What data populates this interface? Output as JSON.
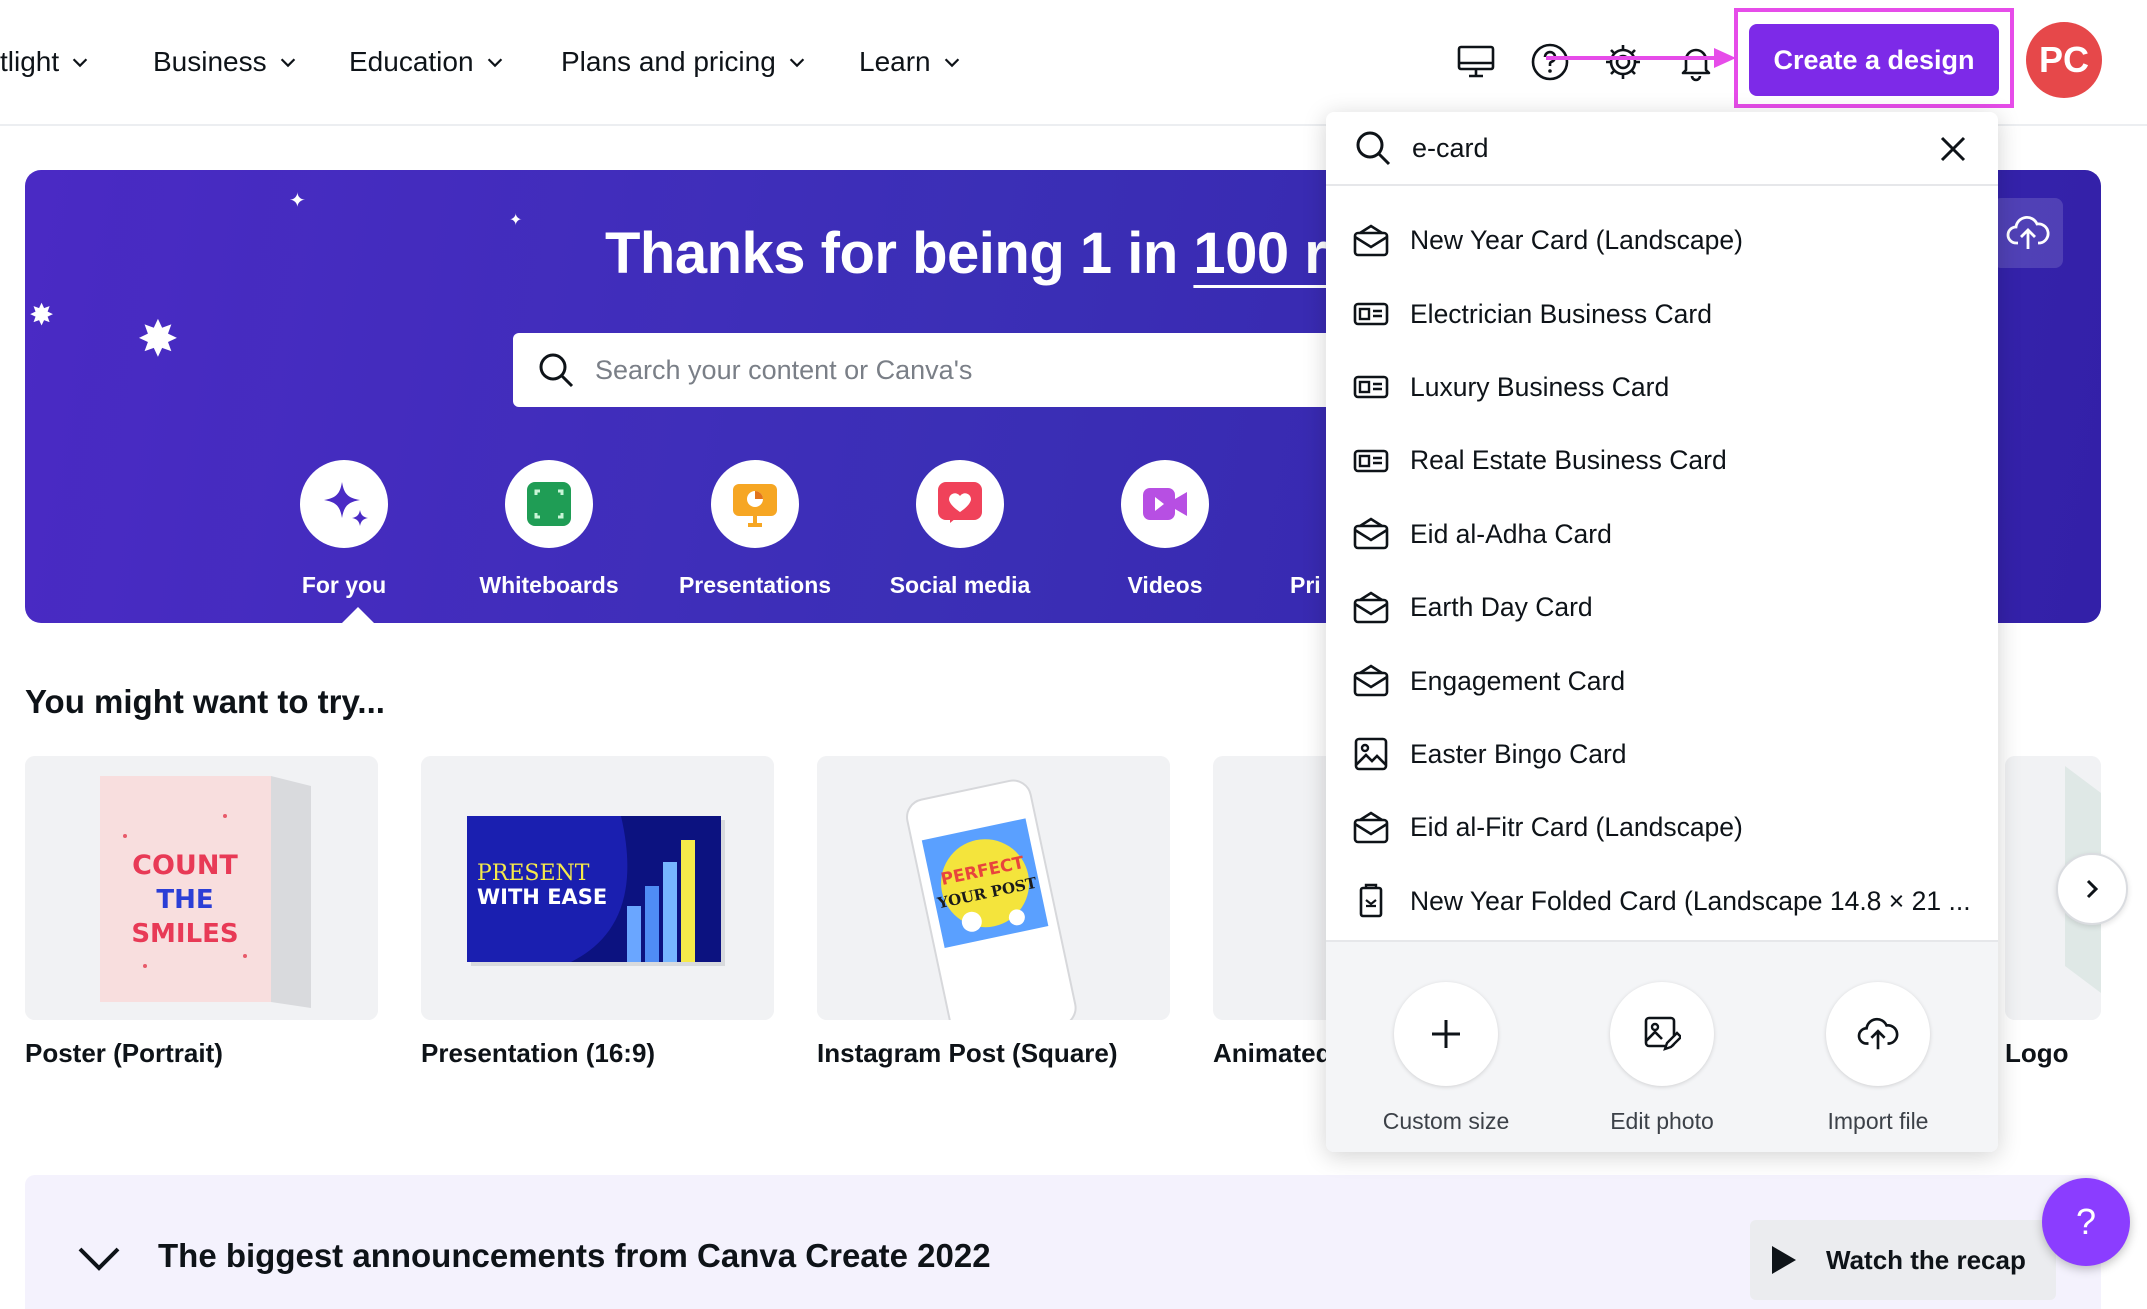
{
  "nav": {
    "items": [
      {
        "label": "tlight"
      },
      {
        "label": "Business"
      },
      {
        "label": "Education"
      },
      {
        "label": "Plans and pricing"
      },
      {
        "label": "Learn"
      }
    ],
    "create_label": "Create a design",
    "avatar_initials": "PC",
    "icons": [
      "desktop-icon",
      "help-icon",
      "gear-icon",
      "bell-icon"
    ]
  },
  "banner": {
    "title_main": "Thanks for being 1 in ",
    "title_underlined": "100 r",
    "search_placeholder": "Search your content or Canva's",
    "categories": [
      {
        "label": "For you",
        "icon": "sparkle-icon"
      },
      {
        "label": "Whiteboards",
        "icon": "whiteboard-icon"
      },
      {
        "label": "Presentations",
        "icon": "presentation-icon"
      },
      {
        "label": "Social media",
        "icon": "heart-icon"
      },
      {
        "label": "Videos",
        "icon": "video-icon"
      },
      {
        "label": "Pri",
        "icon": "print-icon"
      }
    ]
  },
  "suggestions": {
    "title": "You might want to try...",
    "cards": [
      {
        "label": "Poster (Portrait)",
        "art_text": [
          "COUNT",
          "THE",
          "SMILES"
        ]
      },
      {
        "label": "Presentation (16:9)",
        "art_text": [
          "PRESENT",
          "WITH EASE"
        ]
      },
      {
        "label": "Instagram Post (Square)",
        "art_text": [
          "PERFECT",
          "YOUR POST"
        ]
      },
      {
        "label": "Animated"
      },
      {
        "label": "Logo"
      }
    ]
  },
  "search_dropdown": {
    "query": "e-card",
    "results": [
      {
        "label": "New Year Card (Landscape)",
        "icon": "card-icon"
      },
      {
        "label": "Electrician Business Card",
        "icon": "business-card-icon"
      },
      {
        "label": "Luxury Business Card",
        "icon": "business-card-icon"
      },
      {
        "label": "Real Estate Business Card",
        "icon": "business-card-icon"
      },
      {
        "label": "Eid al-Adha Card",
        "icon": "card-icon"
      },
      {
        "label": "Earth Day Card",
        "icon": "card-icon"
      },
      {
        "label": "Engagement Card",
        "icon": "card-icon"
      },
      {
        "label": "Easter Bingo Card",
        "icon": "image-icon"
      },
      {
        "label": "Eid al-Fitr Card (Landscape)",
        "icon": "card-icon"
      },
      {
        "label": "New Year Folded Card (Landscape 14.8 × 21 ...",
        "icon": "folded-card-icon"
      }
    ],
    "actions": [
      {
        "label": "Custom size",
        "icon": "plus-icon"
      },
      {
        "label": "Edit photo",
        "icon": "edit-photo-icon"
      },
      {
        "label": "Import file",
        "icon": "upload-cloud-icon"
      }
    ]
  },
  "bottom": {
    "title": "The biggest announcements from Canva Create 2022",
    "recap_label": "Watch the recap",
    "help_glyph": "?"
  },
  "colors": {
    "brand_purple": "#7d2ae8",
    "annotation_magenta": "#e64ce9",
    "banner_indigo": "#3b2fb6",
    "avatar_red": "#e6484a"
  }
}
